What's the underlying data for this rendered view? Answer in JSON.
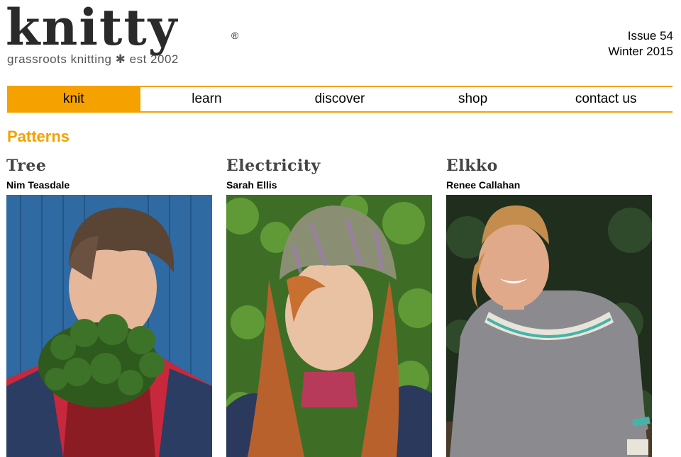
{
  "logo": {
    "wordmark": "knitty",
    "registered": "®",
    "tagline": "grassroots knitting ✱ est 2002"
  },
  "issue": {
    "number": "Issue 54",
    "season": "Winter 2015"
  },
  "nav": [
    {
      "label": "knit",
      "active": true
    },
    {
      "label": "learn",
      "active": false
    },
    {
      "label": "discover",
      "active": false
    },
    {
      "label": "shop",
      "active": false
    },
    {
      "label": "contact us",
      "active": false
    }
  ],
  "section": {
    "title": "Patterns"
  },
  "patterns": [
    {
      "title": "Tree",
      "author": "Nim Teasdale"
    },
    {
      "title": "Electricity",
      "author": "Sarah Ellis"
    },
    {
      "title": "Elkko",
      "author": "Renee Callahan"
    }
  ],
  "colors": {
    "accent": "#f5a100"
  }
}
